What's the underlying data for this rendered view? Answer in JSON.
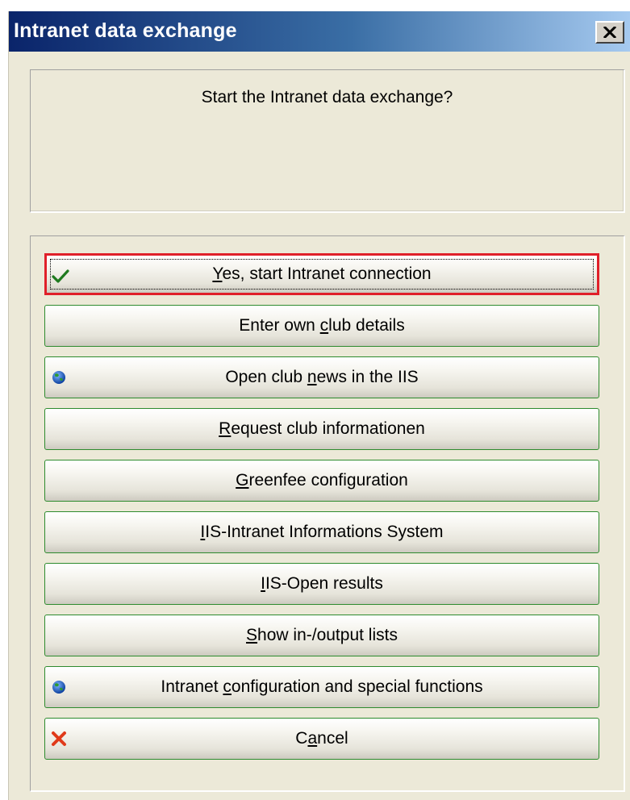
{
  "window": {
    "title": "Intranet data exchange",
    "close_label": "×"
  },
  "message": {
    "text": "Start the Intranet data exchange?"
  },
  "buttons": [
    {
      "pre": "",
      "accel": "Y",
      "post": "es, start Intranet connection",
      "icon": "check-icon",
      "selected": true
    },
    {
      "pre": "Enter own ",
      "accel": "c",
      "post": "lub details",
      "icon": "",
      "selected": false
    },
    {
      "pre": "Open club ",
      "accel": "n",
      "post": "ews in the IIS",
      "icon": "globe-icon",
      "selected": false
    },
    {
      "pre": "",
      "accel": "R",
      "post": "equest club informationen",
      "icon": "",
      "selected": false
    },
    {
      "pre": "",
      "accel": "G",
      "post": "reenfee configuration",
      "icon": "",
      "selected": false
    },
    {
      "pre": "",
      "accel": "I",
      "post": "IS-Intranet Informations System",
      "icon": "",
      "selected": false
    },
    {
      "pre": "",
      "accel": "I",
      "post": "IS-Open results",
      "icon": "",
      "selected": false
    },
    {
      "pre": "",
      "accel": "S",
      "post": "how in-/output lists",
      "icon": "",
      "selected": false
    },
    {
      "pre": "Intranet ",
      "accel": "c",
      "post": "onfiguration and special functions",
      "icon": "globe-icon",
      "selected": false
    },
    {
      "pre": "C",
      "accel": "a",
      "post": "ncel",
      "icon": "cancel-x-icon",
      "selected": false
    }
  ],
  "colors": {
    "title_bar_start": "#0a246a",
    "title_bar_end": "#a6caf0",
    "dialog_background": "#ece9d8",
    "button_border": "#2e8b2e",
    "selected_outline": "#e0202a"
  }
}
